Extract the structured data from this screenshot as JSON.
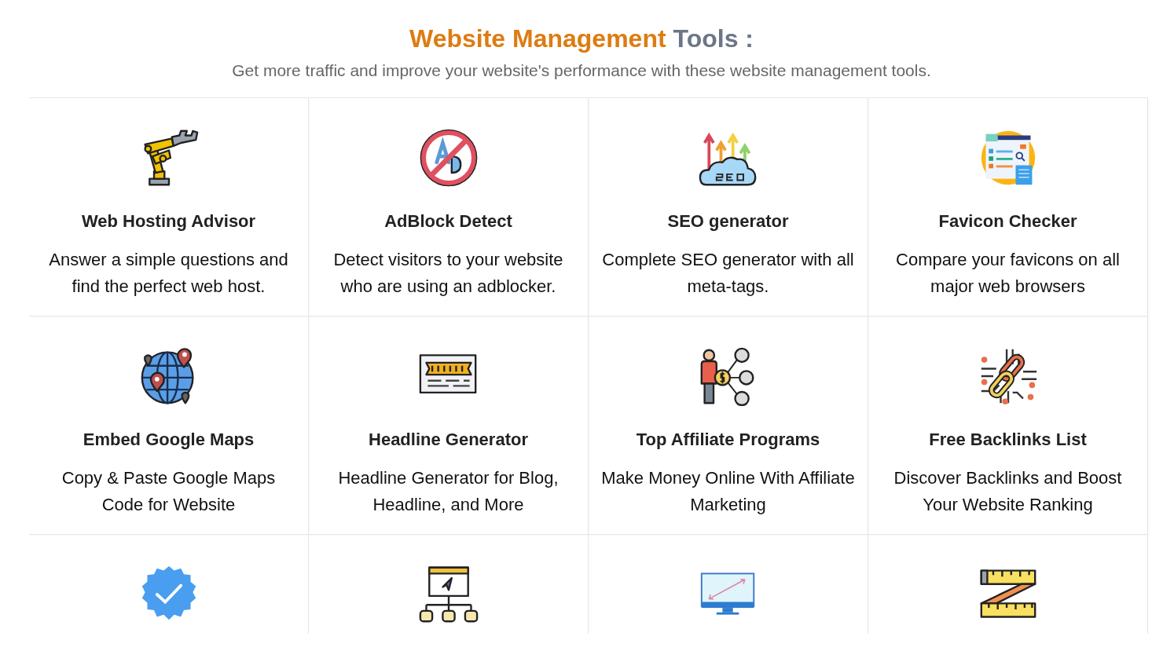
{
  "heading": {
    "highlight": "Website Management",
    "rest": "Tools :"
  },
  "subtitle": "Get more traffic and improve your website's performance with these website management tools.",
  "cards": [
    {
      "title": "Web Hosting Advisor",
      "description": "Answer a simple questions and find the perfect web host."
    },
    {
      "title": "AdBlock Detect",
      "description": "Detect visitors to your website who are using an adblocker."
    },
    {
      "title": "SEO generator",
      "description": "Complete SEO generator with all meta-tags."
    },
    {
      "title": "Favicon Checker",
      "description": "Compare your favicons on all major web browsers"
    },
    {
      "title": "Embed Google Maps",
      "description": "Copy & Paste Google Maps Code for Website"
    },
    {
      "title": "Headline Generator",
      "description": "Headline Generator for Blog, Headline, and More"
    },
    {
      "title": "Top Affiliate Programs",
      "description": "Make Money Online With Affiliate Marketing"
    },
    {
      "title": "Free Backlinks List",
      "description": "Discover Backlinks and Boost Your Website Ranking"
    },
    {
      "kind": "icon_only"
    },
    {
      "kind": "icon_only"
    },
    {
      "kind": "icon_only"
    },
    {
      "kind": "icon_only"
    }
  ]
}
